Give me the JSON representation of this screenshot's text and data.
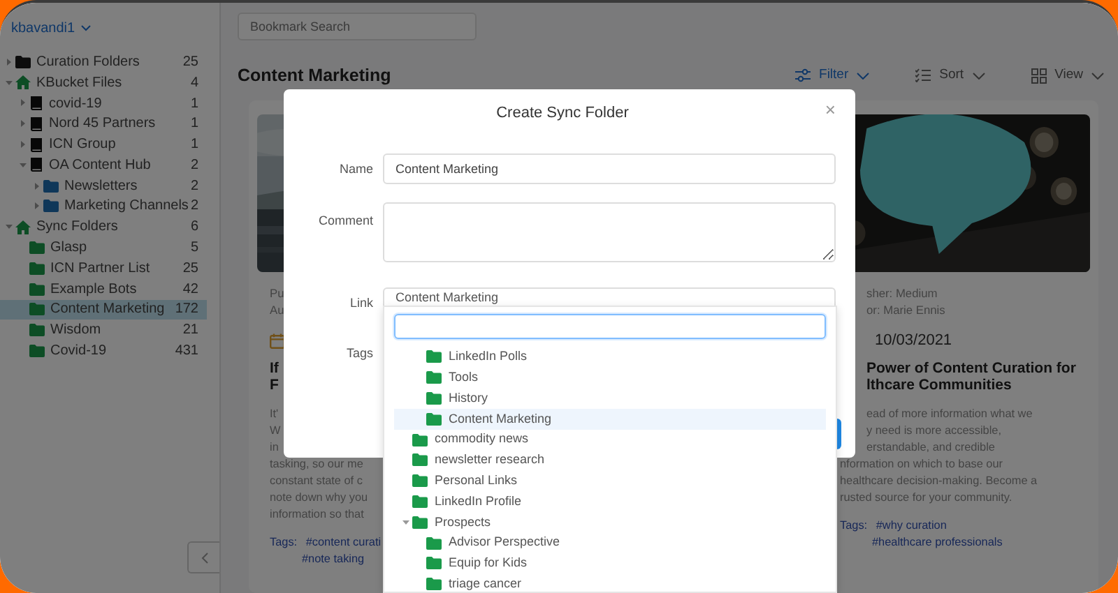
{
  "sidebar": {
    "user_menu": "kbavandi1",
    "tree": [
      {
        "label": "Curation Folders",
        "count": "25",
        "kind": "folder-dark",
        "expanded": false,
        "selected": false
      },
      {
        "label": "KBucket Files",
        "count": "4",
        "kind": "home",
        "expanded": true,
        "selected": false,
        "children": [
          {
            "label": "covid-19",
            "count": "1",
            "kind": "book",
            "expanded": false,
            "selected": false
          },
          {
            "label": "Nord 45 Partners",
            "count": "1",
            "kind": "book",
            "expanded": false,
            "selected": false
          },
          {
            "label": "ICN Group",
            "count": "1",
            "kind": "book",
            "expanded": false,
            "selected": false
          },
          {
            "label": "OA Content Hub",
            "count": "2",
            "kind": "book",
            "expanded": true,
            "selected": false,
            "children": [
              {
                "label": "Newsletters",
                "count": "2",
                "kind": "folder-blue",
                "expanded": false,
                "selected": false
              },
              {
                "label": "Marketing Channels",
                "count": "2",
                "kind": "folder-blue",
                "expanded": false,
                "selected": false
              }
            ]
          }
        ]
      },
      {
        "label": "Sync Folders",
        "count": "6",
        "kind": "home",
        "expanded": true,
        "selected": false,
        "children": [
          {
            "label": "Glasp",
            "count": "5",
            "kind": "folder-green",
            "selected": false
          },
          {
            "label": "ICN Partner List",
            "count": "25",
            "kind": "folder-green",
            "selected": false
          },
          {
            "label": "Example Bots",
            "count": "42",
            "kind": "folder-green",
            "selected": false
          },
          {
            "label": "Content Marketing",
            "count": "172",
            "kind": "folder-green",
            "selected": true
          },
          {
            "label": "Wisdom",
            "count": "21",
            "kind": "folder-green",
            "selected": false
          },
          {
            "label": "Covid-19",
            "count": "431",
            "kind": "folder-green",
            "selected": false
          }
        ]
      }
    ]
  },
  "main": {
    "search": {
      "placeholder": "Bookmark Search"
    },
    "heading": "Content Marketing",
    "toolbar": [
      {
        "label": "Filter",
        "kind": "sliders",
        "active": true
      },
      {
        "label": "Sort",
        "kind": "sort",
        "active": false
      },
      {
        "label": "View",
        "kind": "grid",
        "active": false
      }
    ]
  },
  "cards": [
    {
      "publisher": "Pu",
      "author": "Au",
      "date_icon": true,
      "title_lines": [
        "If",
        "F"
      ],
      "summary_lines": [
        "It'",
        "W",
        "in",
        "tasking, so our me",
        "constant state of c",
        "note down why you",
        "information so that"
      ],
      "tags_label": "Tags:",
      "tags": [
        "#content curati",
        "#note taking"
      ]
    },
    {
      "publisher": "sher: Medium",
      "author": "or: Marie Ennis",
      "date_icon": false,
      "date": "10/03/2021",
      "title_lines": [
        "Power of Content Curation for",
        "lthcare Communities"
      ],
      "summary_lines": [
        "ead of more information what we",
        "y need is more accessible,",
        "erstandable, and credible",
        "nformation on which to base our",
        "healthcare decision-making. Become a",
        "rusted source for your community."
      ],
      "tags_label": "Tags:",
      "tags": [
        "#why curation",
        "#healthcare professionals"
      ]
    }
  ],
  "modal": {
    "title": "Create Sync Folder",
    "close": "×",
    "name": {
      "label": "Name",
      "value": "Content Marketing"
    },
    "comment": {
      "label": "Comment"
    },
    "link": {
      "label": "Link",
      "value": "Content Marketing"
    },
    "tags": {
      "label": "Tags"
    }
  },
  "link_dropdown": {
    "scrolled_items": [
      {
        "label": "LinkedIn Polls",
        "selected": false
      },
      {
        "label": "Tools",
        "selected": false
      },
      {
        "label": "History",
        "selected": false
      },
      {
        "label": "Content Marketing",
        "selected": true
      }
    ],
    "items": [
      {
        "label": "commodity news",
        "selected": false
      },
      {
        "label": "newsletter research",
        "selected": false
      },
      {
        "label": "Personal Links",
        "selected": false
      },
      {
        "label": "LinkedIn Profile",
        "selected": false
      },
      {
        "label": "Prospects",
        "selected": false,
        "expanded": true,
        "children": [
          {
            "label": "Advisor Perspective",
            "selected": false
          },
          {
            "label": "Equip for Kids",
            "selected": false
          },
          {
            "label": "triage cancer",
            "selected": false
          }
        ]
      }
    ]
  }
}
